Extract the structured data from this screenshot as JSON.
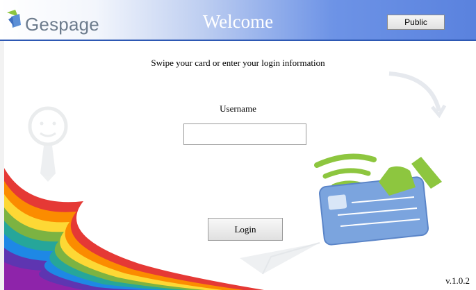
{
  "header": {
    "logo_text": "Gespage",
    "title": "Welcome",
    "public_button": "Public"
  },
  "login": {
    "instructions": "Swipe your card or enter your login information",
    "username_label": "Username",
    "username_value": "",
    "login_button": "Login"
  },
  "footer": {
    "version": "v.1.0.2"
  },
  "colors": {
    "header_blue": "#5a82de",
    "card_blue": "#6f9ad8",
    "accent_green": "#8dc63f"
  },
  "icons": [
    "gespage-logo-icon",
    "card-reader-icon",
    "person-sketch-icon",
    "paper-plane-icon",
    "page-curl-icon"
  ]
}
